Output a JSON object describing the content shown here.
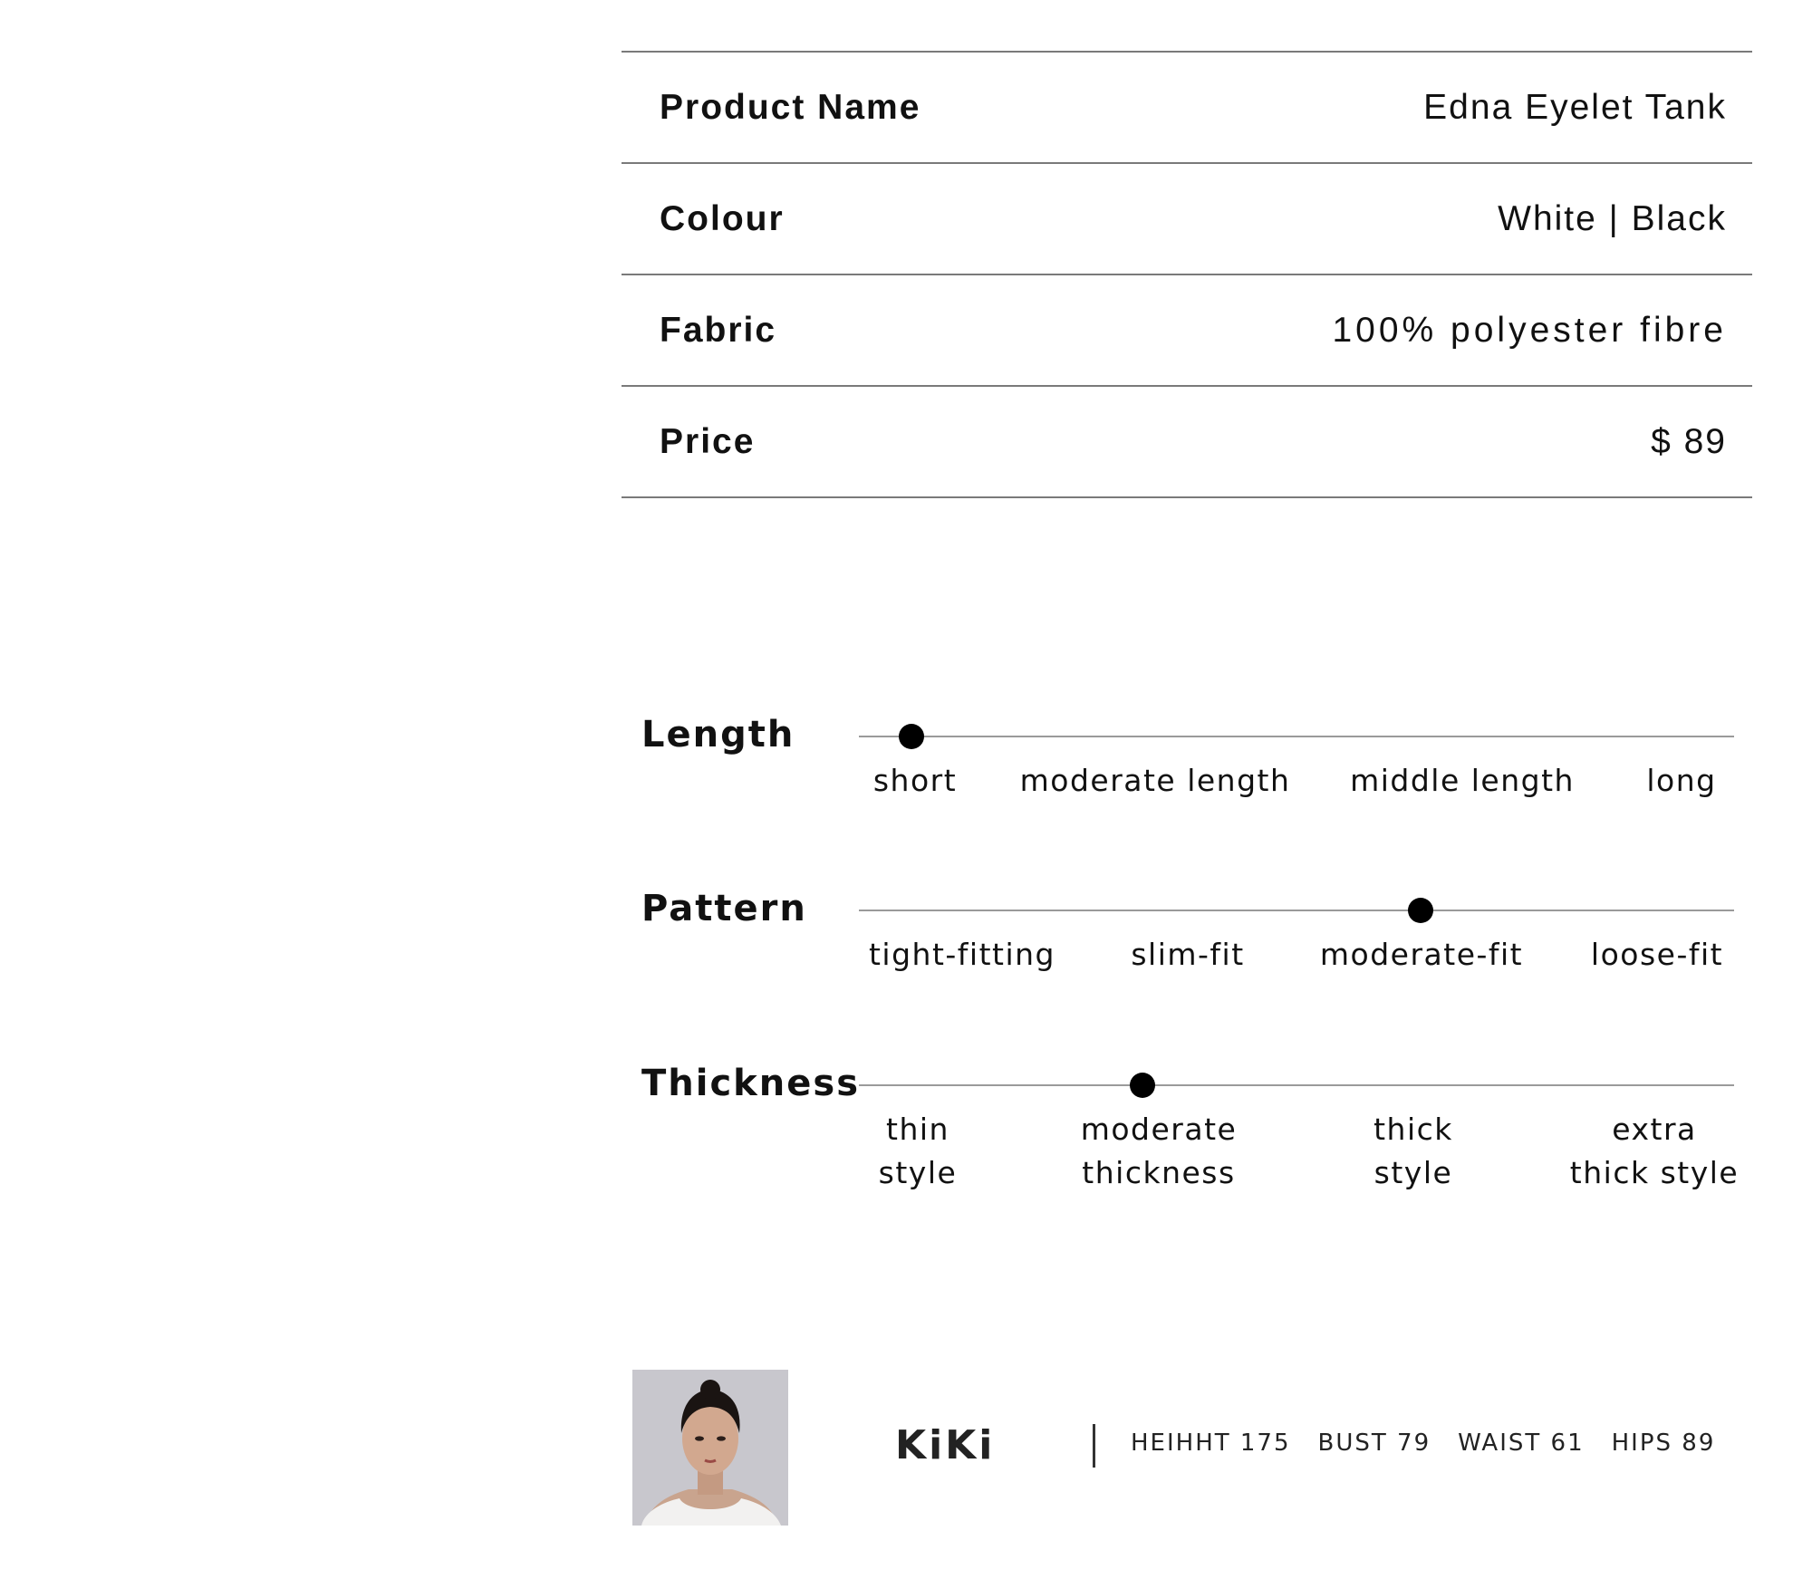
{
  "specs": [
    {
      "label": "Product Name",
      "value": "Edna Eyelet Tank"
    },
    {
      "label": "Colour",
      "value": "White | Black"
    },
    {
      "label": "Fabric",
      "value": "100% polyester fibre"
    },
    {
      "label": "Price",
      "value": "$ 89"
    }
  ],
  "scales": {
    "length": {
      "title": "Length",
      "options": [
        "short",
        "moderate length",
        "middle length",
        "long"
      ],
      "selected": "short"
    },
    "pattern": {
      "title": "Pattern",
      "options": [
        "tight-fitting",
        "slim-fit",
        "moderate-fit",
        "loose-fit"
      ],
      "selected": "moderate-fit"
    },
    "thickness": {
      "title": "Thickness",
      "options": [
        "thin\nstyle",
        "moderate\nthickness",
        "thick\nstyle",
        "extra\nthick style"
      ],
      "selected": "moderate\nthickness"
    }
  },
  "model": {
    "name": "KiKi",
    "height": "HEIHHT 175",
    "bust": "BUST 79",
    "waist": "WAIST 61",
    "hips": "HIPS 89"
  }
}
